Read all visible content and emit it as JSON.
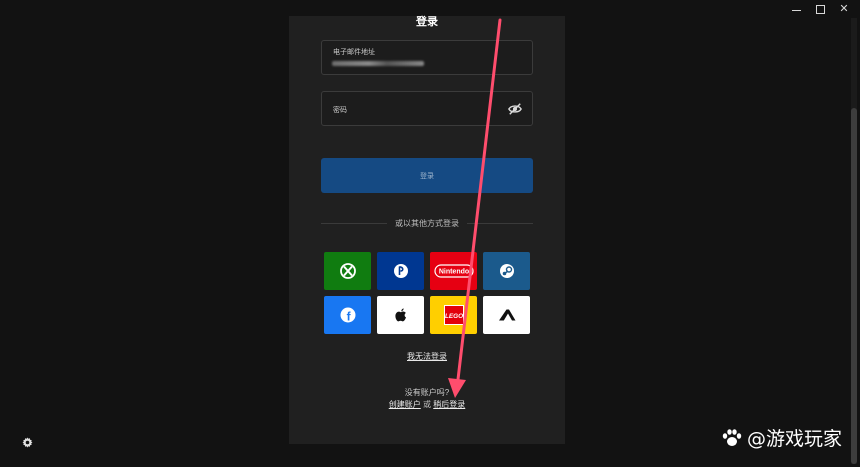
{
  "window": {
    "minimize_icon": "minimize-icon",
    "maximize_icon": "maximize-icon",
    "close_glyph": "✕"
  },
  "form": {
    "title": "登录",
    "email_label": "电子邮件地址",
    "password_label": "密码",
    "login_button": "登录",
    "divider_text": "或以其他方式登录",
    "providers": [
      {
        "name": "xbox",
        "color": "#107c10"
      },
      {
        "name": "playstation",
        "color": "#003791"
      },
      {
        "name": "nintendo",
        "color": "#e60012",
        "label": "Nintendo"
      },
      {
        "name": "steam",
        "color": "#1b5a8c"
      },
      {
        "name": "facebook",
        "color": "#1877f2",
        "label": "f"
      },
      {
        "name": "apple",
        "color": "#ffffff"
      },
      {
        "name": "lego",
        "color": "#ffcf00",
        "label": "LEGO"
      },
      {
        "name": "epic",
        "color": "#ffffff"
      }
    ],
    "cant_login": "我无法登录",
    "no_account": "没有账户吗?",
    "create_account": "创建账户",
    "or": "或",
    "login_later": "稍后登录"
  },
  "watermark": {
    "text": "@游戏玩家"
  },
  "colors": {
    "accent_button": "#154a83",
    "annotation_arrow": "#ff4d6d",
    "background": "#121212",
    "panel": "#202020"
  }
}
